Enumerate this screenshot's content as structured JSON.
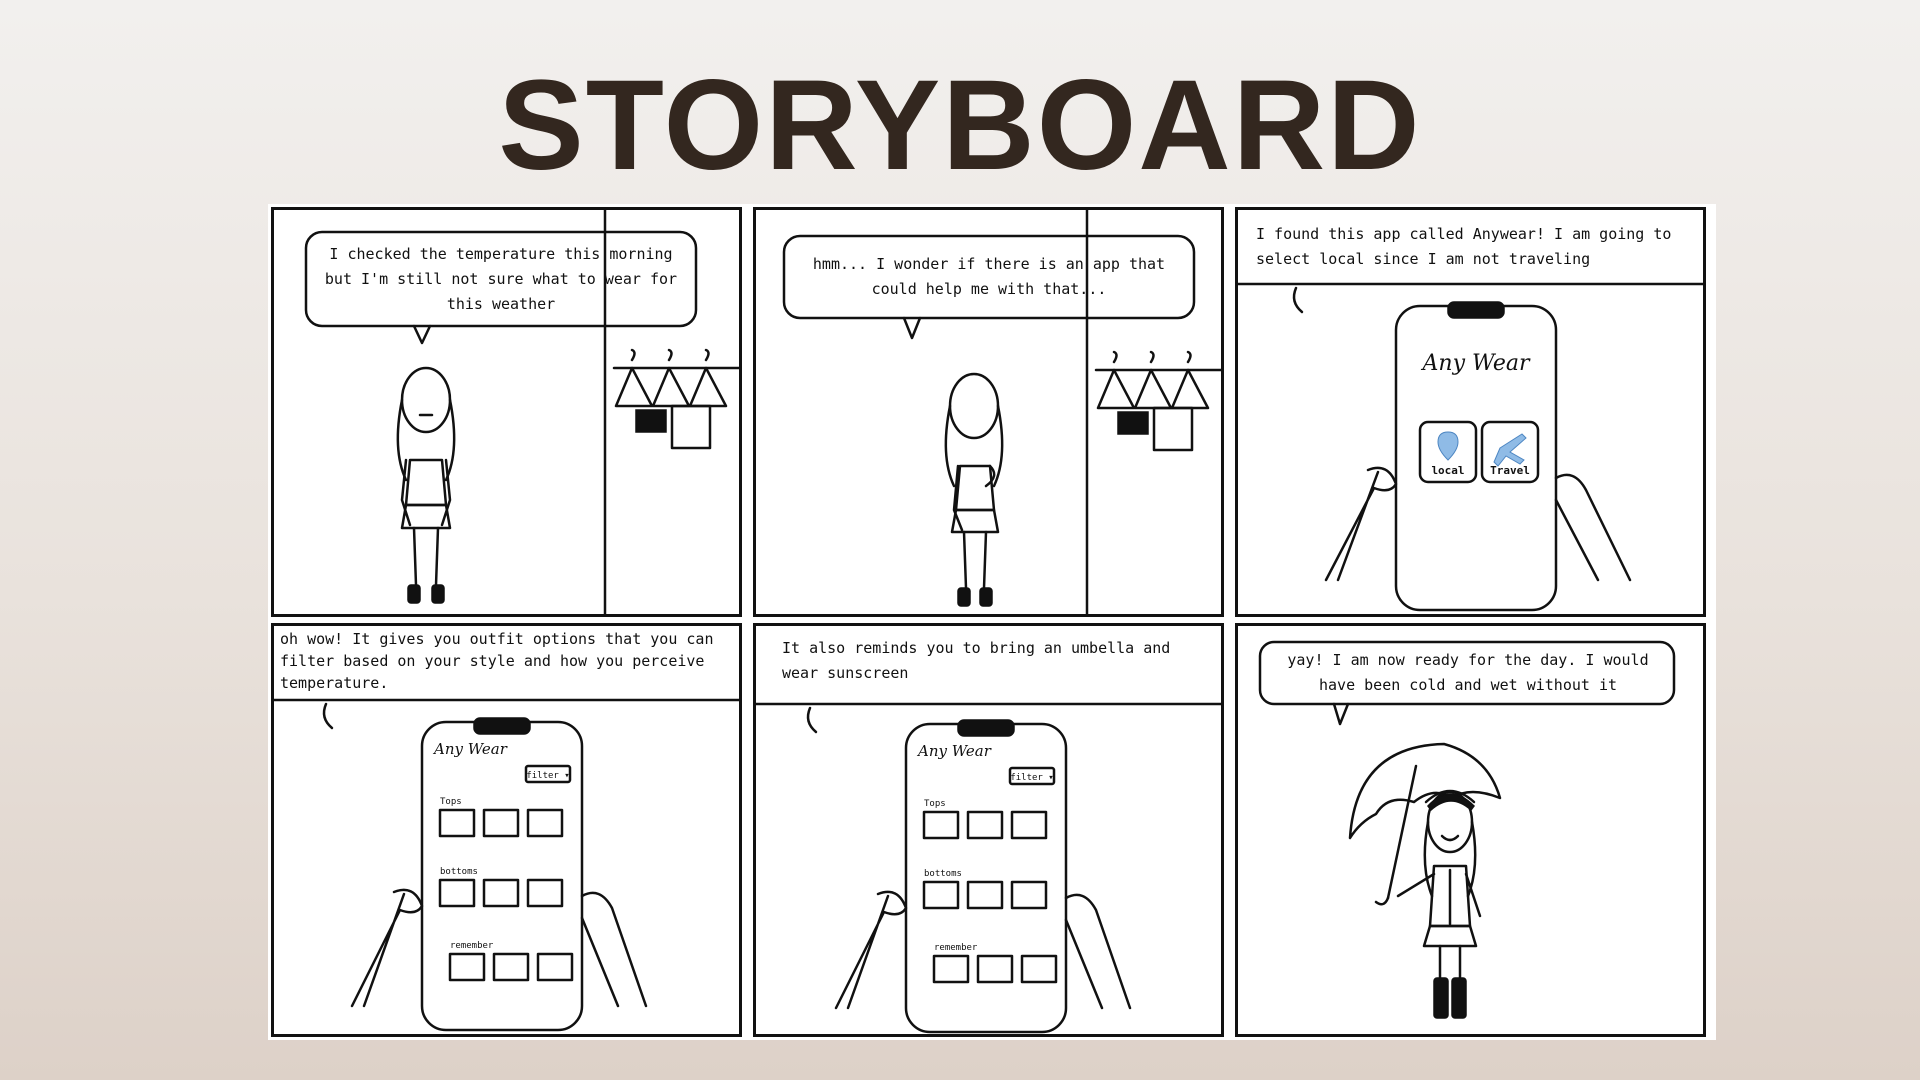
{
  "page": {
    "title": "STORYBOARD"
  },
  "panels": [
    {
      "caption": "I checked the temperature this morning but I'm still not sure what to wear for this weather"
    },
    {
      "caption": "hmm... I wonder if there is an app that could help me with that..."
    },
    {
      "caption": "I found this app called Anywear! I am going to select local since I am not traveling"
    },
    {
      "caption": "oh wow! It gives you outfit options that you can filter based on your style and how you perceive temperature."
    },
    {
      "caption": "It also reminds you to bring an umbella and wear sunscreen"
    },
    {
      "caption": "yay! I am now ready for the day. I would have been cold and wet without it"
    }
  ],
  "app": {
    "logo": "Any Wear",
    "home_options": [
      "local",
      "Travel"
    ],
    "filter_label": "filter ▾",
    "sections": [
      "Tops",
      "bottoms",
      "remember"
    ]
  },
  "colors": {
    "title": "#33271f",
    "accent_blue": "#8fbbe6",
    "ink": "#111111"
  },
  "icons": [
    "location-pin-icon",
    "airplane-icon",
    "hanger-icon",
    "umbrella-icon"
  ]
}
